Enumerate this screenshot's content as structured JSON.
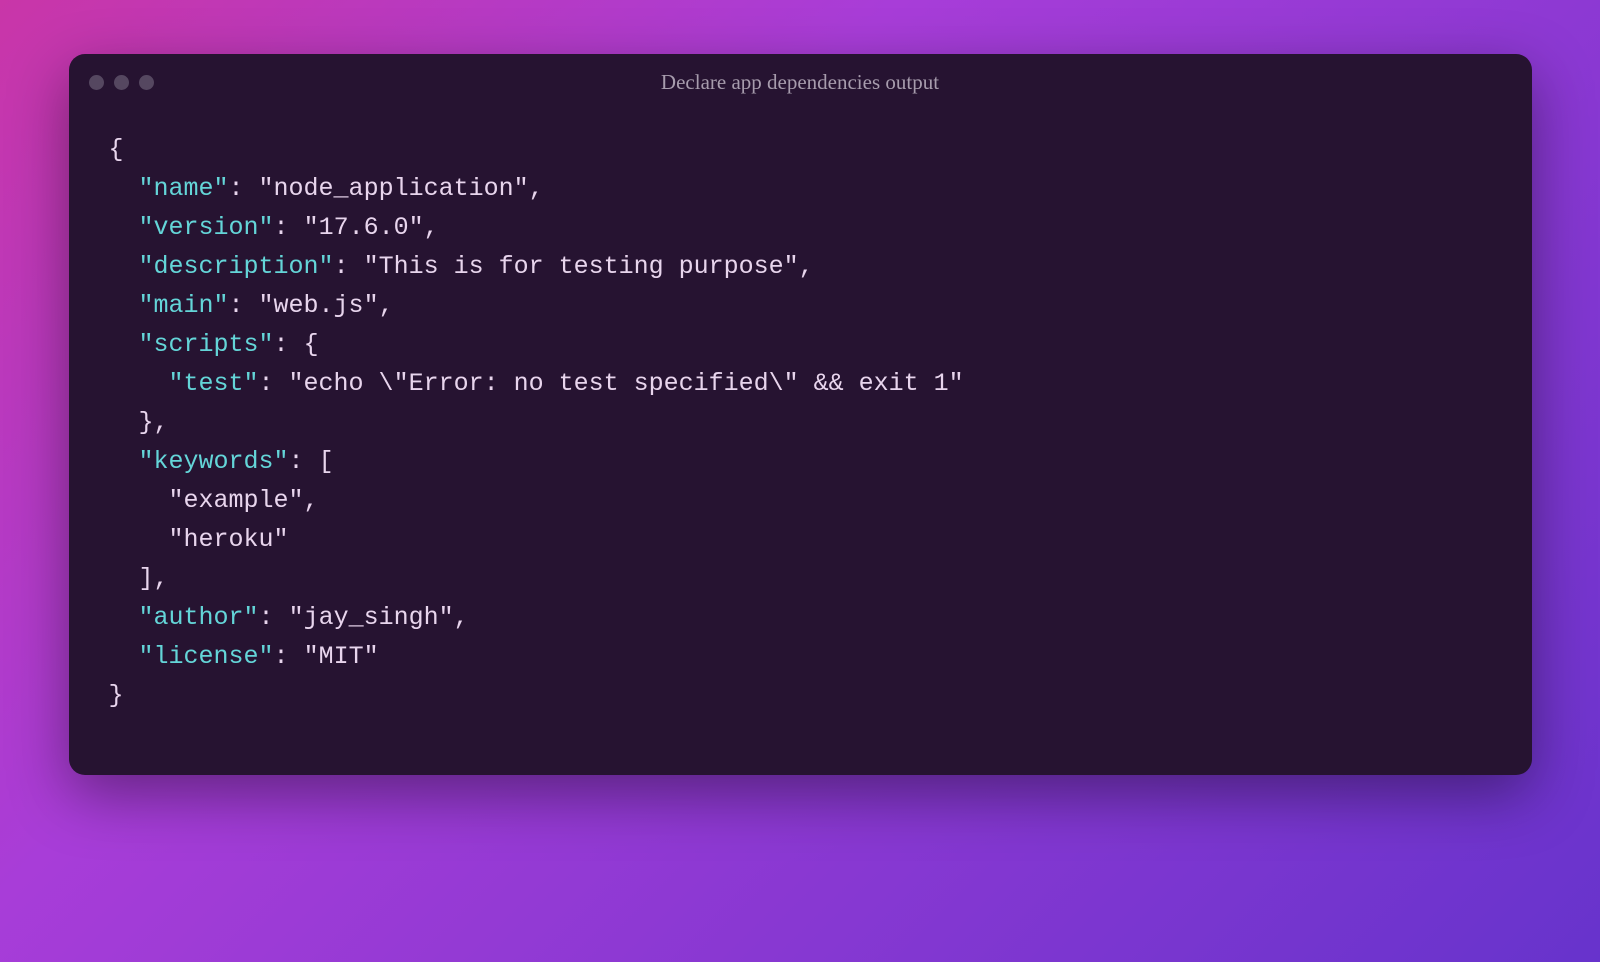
{
  "window": {
    "title": "Declare app dependencies output"
  },
  "code": {
    "brace_open": "{",
    "brace_close": "}",
    "bracket_open": "[",
    "bracket_close": "]",
    "entries": {
      "name_key": "\"name\"",
      "name_val": "\"node_application\"",
      "version_key": "\"version\"",
      "version_val": "\"17.6.0\"",
      "description_key": "\"description\"",
      "description_val": "\"This is for testing purpose\"",
      "main_key": "\"main\"",
      "main_val": "\"web.js\"",
      "scripts_key": "\"scripts\"",
      "test_key": "\"test\"",
      "test_val": "\"echo \\\"Error: no test specified\\\" && exit 1\"",
      "keywords_key": "\"keywords\"",
      "keyword_0": "\"example\"",
      "keyword_1": "\"heroku\"",
      "author_key": "\"author\"",
      "author_val": "\"jay_singh\"",
      "license_key": "\"license\"",
      "license_val": "\"MIT\""
    }
  }
}
